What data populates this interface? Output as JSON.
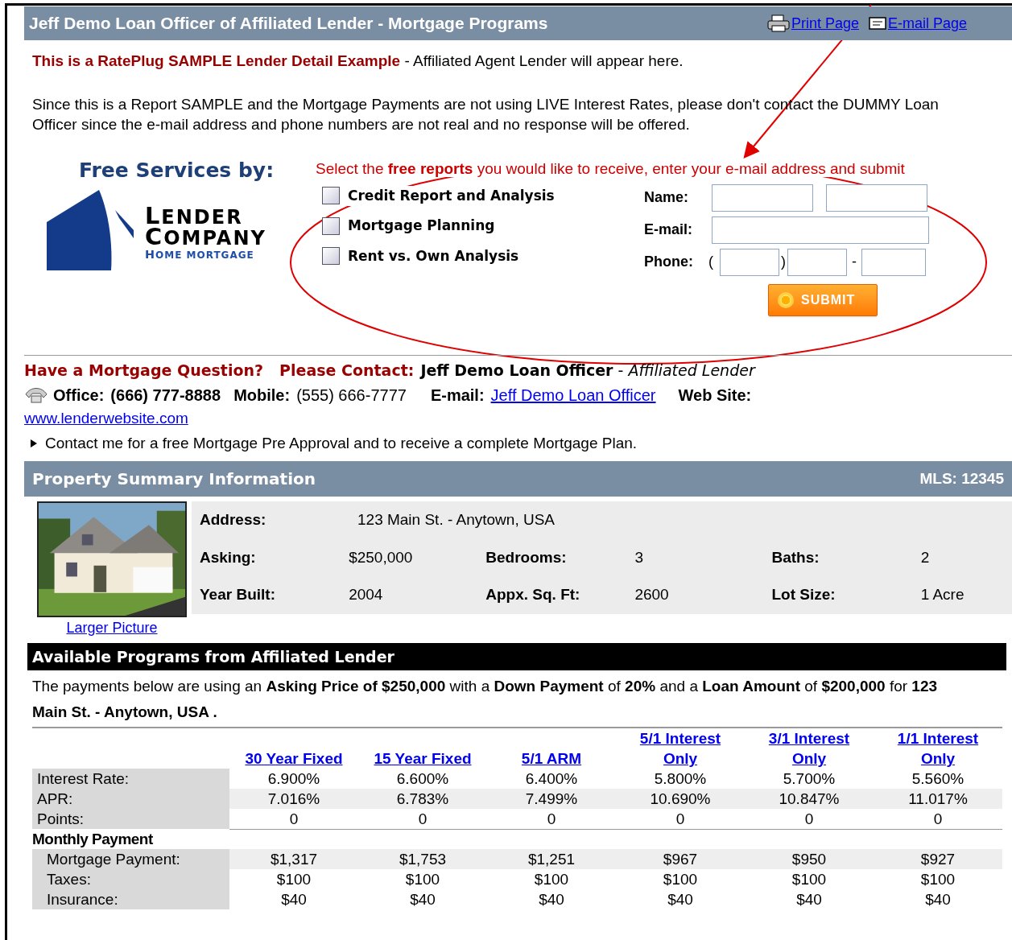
{
  "header": {
    "title": "Jeff Demo Loan Officer of Affiliated Lender - Mortgage Programs",
    "links": [
      {
        "label": "Print Page"
      },
      {
        "label": "E-mail Page"
      }
    ]
  },
  "notice": {
    "highlight": "This is a RatePlug SAMPLE Lender Detail Example",
    "rest": " - Affiliated Agent Lender will appear here."
  },
  "disclaimer": "Since this is a Report SAMPLE and the Mortgage Payments are not using LIVE Interest Rates, please don't contact the DUMMY Loan Officer since the e-mail address and phone numbers are not real and no response will be offered.",
  "services": {
    "heading": "Free Services by:",
    "logo": [
      "LENDER",
      "COMPANY",
      "HOME MORTGAGE"
    ]
  },
  "form": {
    "prompt": "Select the **free reports** you would like to receive, enter your e-mail address and submit",
    "reports": [
      {
        "label": "Credit Report and Analysis",
        "checked": false
      },
      {
        "label": "Mortgage Planning",
        "checked": false
      },
      {
        "label": "Rent vs. Own Analysis",
        "checked": false
      }
    ],
    "name_label": "Name:",
    "email_label": "E-mail:",
    "phone_label": "Phone:",
    "phone_open": "(",
    "phone_close": ")",
    "phone_dash": "-",
    "submit": "SUBMIT"
  },
  "contact": {
    "question": "Have a Mortgage Question?",
    "please": "Please Contact:",
    "officer": "Jeff Demo Loan Officer",
    "separator": " - ",
    "lender": "Affiliated Lender",
    "office_label": "Office:",
    "office": "(666) 777-8888",
    "mobile_label": "Mobile:",
    "mobile": "(555) 666-7777",
    "email_label": "E-mail:",
    "email_link": "Jeff Demo Loan Officer",
    "web_label": "Web Site:",
    "web_link": "www.lenderwebsite.com",
    "cta": "Contact me for a free Mortgage Pre Approval and to receive a complete Mortgage Plan."
  },
  "property": {
    "title": "Property Summary Information",
    "mls": "MLS: 12345",
    "photo_link": "Larger Picture",
    "rows": [
      [
        {
          "label": "Address:",
          "value": "123 Main St. - Anytown, USA"
        }
      ],
      [
        {
          "label": "Asking:",
          "value": "$250,000"
        },
        {
          "label": "Bedrooms:",
          "value": "3"
        },
        {
          "label": "Baths:",
          "value": "2"
        }
      ],
      [
        {
          "label": "Year Built:",
          "value": "2004"
        },
        {
          "label": "Appx. Sq. Ft:",
          "value": "2600"
        },
        {
          "label": "Lot Size:",
          "value": "1 Acre"
        }
      ]
    ]
  },
  "programs": {
    "title": "Available Programs from Affiliated Lender",
    "intro": "The payments below are using an **Asking Price of $250,000** with a **Down Payment** of **20%** and a **Loan Amount** of **$200,000** for **123 Main St. - Anytown, USA .**",
    "columns": [
      "30 Year Fixed",
      "15 Year Fixed",
      "5/1 ARM",
      "5/1 Interest Only",
      "3/1 Interest Only",
      "1/1 Interest Only"
    ],
    "rows": [
      {
        "kind": "value",
        "label": "Interest Rate:",
        "values": [
          "6.900%",
          "6.600%",
          "6.400%",
          "5.800%",
          "5.700%",
          "5.560%"
        ]
      },
      {
        "kind": "value",
        "label": "APR:",
        "values": [
          "7.016%",
          "6.783%",
          "7.499%",
          "10.690%",
          "10.847%",
          "11.017%"
        ]
      },
      {
        "kind": "value",
        "label": "Points:",
        "values": [
          "0",
          "0",
          "0",
          "0",
          "0",
          "0"
        ]
      },
      {
        "kind": "section",
        "label": "Monthly Payment"
      },
      {
        "kind": "sub",
        "label": "Mortgage Payment:",
        "values": [
          "$1,317",
          "$1,753",
          "$1,251",
          "$967",
          "$950",
          "$927"
        ]
      },
      {
        "kind": "sub",
        "label": "Taxes:",
        "values": [
          "$100",
          "$100",
          "$100",
          "$100",
          "$100",
          "$100"
        ]
      },
      {
        "kind": "sub",
        "label": "Insurance:",
        "values": [
          "$40",
          "$40",
          "$40",
          "$40",
          "$40",
          "$40"
        ]
      }
    ]
  }
}
